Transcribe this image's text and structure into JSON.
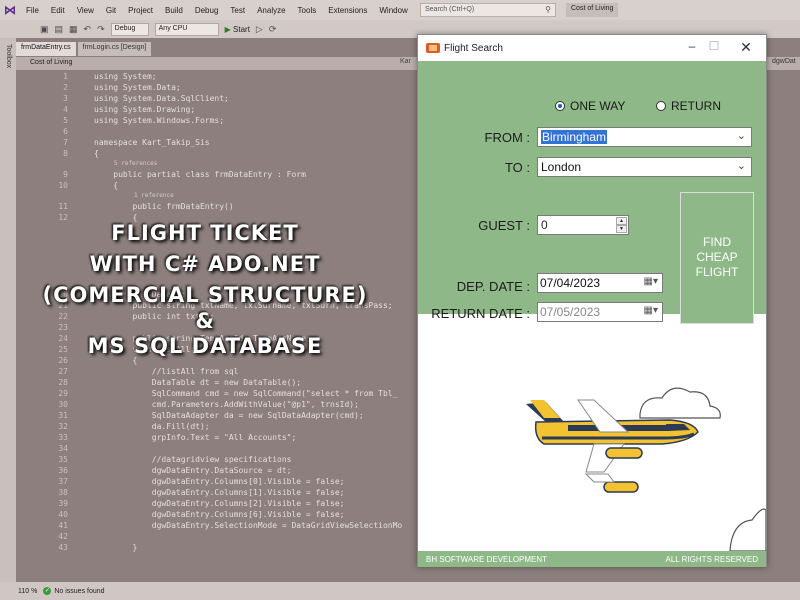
{
  "ide": {
    "menu": [
      "File",
      "Edit",
      "View",
      "Git",
      "Project",
      "Build",
      "Debug",
      "Test",
      "Analyze",
      "Tools",
      "Extensions",
      "Window",
      "Help"
    ],
    "search_placeholder": "Search (Ctrl+Q)",
    "solution_name": "Cost of Living",
    "config": "Debug",
    "platform": "Any CPU",
    "start": "Start",
    "toolbox_label": "Toolbox",
    "tabs": [
      "frmDataEntry.cs",
      "frmLogin.cs [Design]"
    ],
    "navbar_text": "Cost of Living",
    "mid_tab": "Kar",
    "right_tab": "dgwDat",
    "zoom": "110 %",
    "status_text": "No issues found"
  },
  "code_lines": [
    {
      "n": "1",
      "t": "using System;"
    },
    {
      "n": "2",
      "t": "using System.Data;"
    },
    {
      "n": "3",
      "t": "using System.Data.SqlClient;"
    },
    {
      "n": "4",
      "t": "using System.Drawing;"
    },
    {
      "n": "5",
      "t": "using System.Windows.Forms;"
    },
    {
      "n": "6",
      "t": ""
    },
    {
      "n": "7",
      "t": "namespace Kart_Takip_Sis"
    },
    {
      "n": "8",
      "t": "{"
    },
    {
      "n": "9",
      "t": "    public partial class frmDataEntry : Form"
    },
    {
      "n": "10",
      "t": "    {"
    },
    {
      "n": "11",
      "t": "        public frmDataEntry()"
    },
    {
      "n": "12",
      "t": "        {"
    },
    {
      "n": "20",
      "t": "        int DataId;"
    },
    {
      "n": "21",
      "t": "        public string txtName, txtSurname, txtSurn, transPass;"
    },
    {
      "n": "22",
      "t": "        public int txtId;"
    },
    {
      "n": "23",
      "t": ""
    },
    {
      "n": "24",
      "t": "        public string TempAccId, TempAccName;"
    },
    {
      "n": "25",
      "t": "        void ListAll()"
    },
    {
      "n": "26",
      "t": "        {"
    },
    {
      "n": "27",
      "t": "            //listAll from sql"
    },
    {
      "n": "28",
      "t": "            DataTable dt = new DataTable();"
    },
    {
      "n": "29",
      "t": "            SqlCommand cmd = new SqlCommand(\"select * from Tbl_"
    },
    {
      "n": "30",
      "t": "            cmd.Parameters.AddWithValue(\"@p1\", trnsId);"
    },
    {
      "n": "31",
      "t": "            SqlDataAdapter da = new SqlDataAdapter(cmd);"
    },
    {
      "n": "32",
      "t": "            da.Fill(dt);"
    },
    {
      "n": "33",
      "t": "            grpInfo.Text = \"All Accounts\";"
    },
    {
      "n": "34",
      "t": ""
    },
    {
      "n": "35",
      "t": "            //datagridview specifications"
    },
    {
      "n": "36",
      "t": "            dgwDataEntry.DataSource = dt;"
    },
    {
      "n": "37",
      "t": "            dgwDataEntry.Columns[0].Visible = false;"
    },
    {
      "n": "38",
      "t": "            dgwDataEntry.Columns[1].Visible = false;"
    },
    {
      "n": "39",
      "t": "            dgwDataEntry.Columns[2].Visible = false;"
    },
    {
      "n": "40",
      "t": "            dgwDataEntry.Columns[6].Visible = false;"
    },
    {
      "n": "41",
      "t": "            dgwDataEntry.SelectionMode = DataGridViewSelectionMo"
    },
    {
      "n": "42",
      "t": ""
    },
    {
      "n": "43",
      "t": "        }"
    }
  ],
  "refs": {
    "five": "5 references",
    "one": "1 reference"
  },
  "overlay": {
    "line1": "FLIGHT TICKET",
    "line2": "WITH C# ADO.NET",
    "line3": "(COMERCIAL STRUCTURE)",
    "line4": "&",
    "line5": "MS SQL DATABASE"
  },
  "form": {
    "title": "Flight Search",
    "one_way": "ONE WAY",
    "return": "RETURN",
    "from_label": "FROM :",
    "from_value": "Birmingham",
    "to_label": "TO :",
    "to_value": "London",
    "guest_label": "GUEST :",
    "guest_value": "0",
    "dep_label": "DEP. DATE :",
    "dep_value": "07/04/2023",
    "return_label": "RETURN DATE :",
    "return_value": "07/05/2023",
    "find_line1": "FIND",
    "find_line2": "CHEAP",
    "find_line3": "FLIGHT",
    "footer_left": "BH SOFTWARE DEVELOPMENT",
    "footer_right": "ALL RIGHTS RESERVED"
  },
  "colors": {
    "form_green": "#8fb888",
    "plane_yellow": "#f2c230",
    "plane_navy": "#2b3a55"
  }
}
